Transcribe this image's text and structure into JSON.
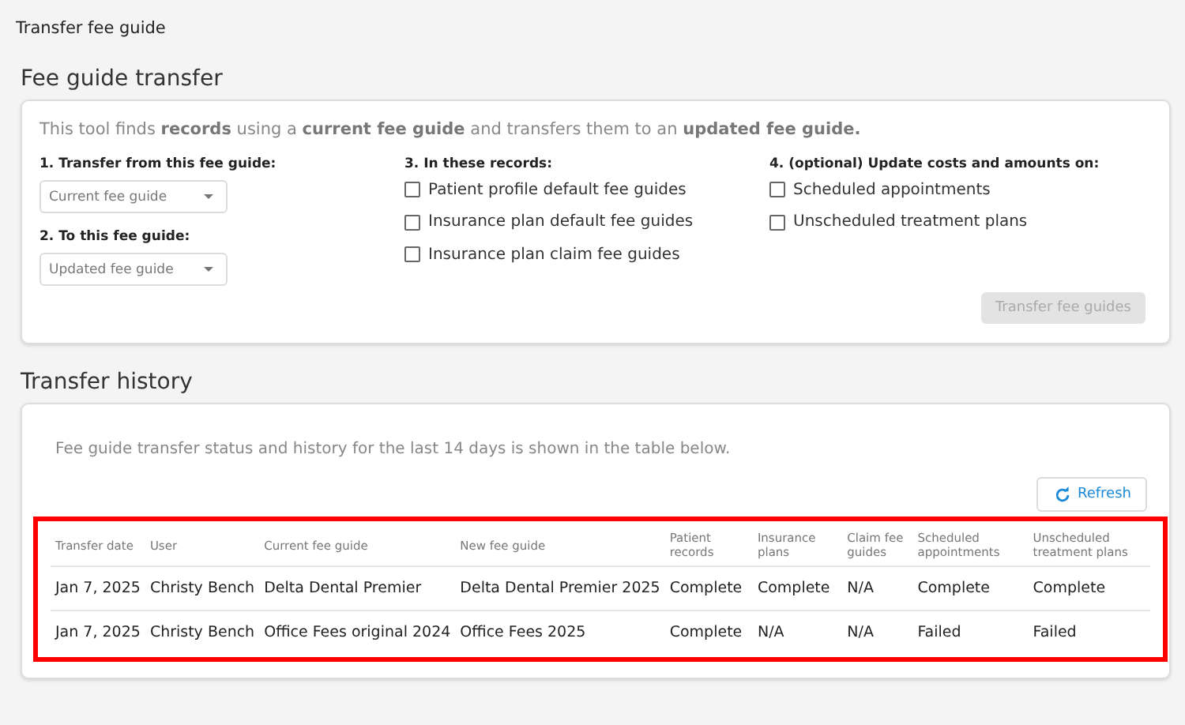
{
  "page_title": "Transfer fee guide",
  "transfer": {
    "heading": "Fee guide transfer",
    "intro": "This tool finds **records** using a **current fee guide** and transfers them to an **updated fee guide.**",
    "steps": [
      {
        "label": "1. Transfer from this fee guide:",
        "kind": "select",
        "placeholder": "Current fee guide"
      },
      {
        "label": "2. To this fee guide:",
        "kind": "select",
        "placeholder": "Updated fee guide"
      },
      {
        "label": "3. In these records:",
        "kind": "checks",
        "options": [
          {
            "label": "Patient profile default fee guides",
            "checked": false
          },
          {
            "label": "Insurance plan default fee guides",
            "checked": false
          },
          {
            "label": "Insurance plan claim fee guides",
            "checked": false
          }
        ]
      },
      {
        "label": "4. (optional) Update costs and amounts on:",
        "kind": "checks",
        "options": [
          {
            "label": "Scheduled appointments",
            "checked": false
          },
          {
            "label": "Unscheduled treatment plans",
            "checked": false
          }
        ]
      }
    ],
    "button": {
      "label": "Transfer fee guides",
      "disabled": true
    }
  },
  "history": {
    "heading": "Transfer history",
    "intro": "Fee guide transfer status and history for the last 14 days is shown in the table below.",
    "refresh": "Refresh",
    "highlighted": true,
    "columns": [
      "Transfer date",
      "User",
      "Current fee guide",
      "New fee guide",
      "Patient records",
      "Insurance plans",
      "Claim fee guides",
      "Scheduled appointments",
      "Unscheduled treatment plans"
    ],
    "rows": [
      [
        "Jan 7, 2025",
        "Christy Bench",
        "Delta Dental Premier",
        "Delta Dental Premier 2025",
        "Complete",
        "Complete",
        "N/A",
        "Complete",
        "Complete"
      ],
      [
        "Jan 7, 2025",
        "Christy Bench",
        "Office Fees original 2024",
        "Office Fees 2025",
        "Complete",
        "N/A",
        "N/A",
        "Failed",
        "Failed"
      ]
    ]
  }
}
